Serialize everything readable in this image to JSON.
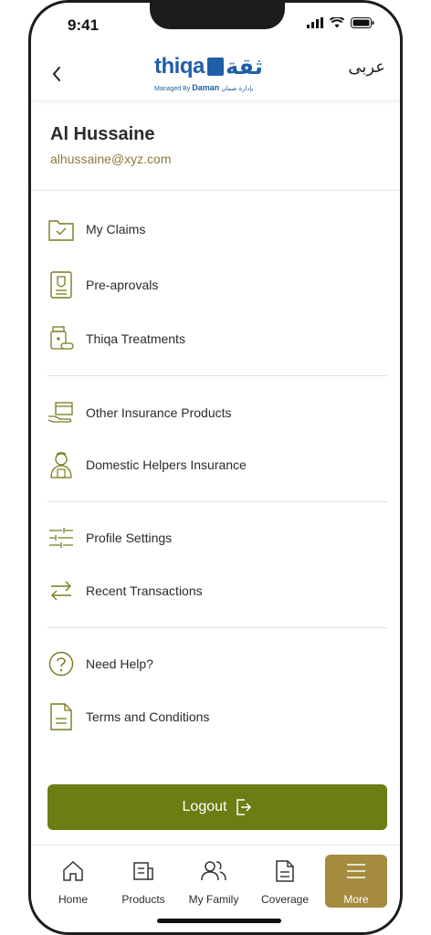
{
  "status_bar": {
    "time": "9:41"
  },
  "header": {
    "logo_wordmark": "thiqa",
    "logo_arabic": "ثقة",
    "logo_managed_by": "Managed By",
    "logo_daman": "Daman",
    "logo_daman_arabic": "بإدارة ضمان",
    "language_toggle": "عربى"
  },
  "profile": {
    "name": "Al Hussaine",
    "email": "alhussaine@xyz.com"
  },
  "menu": {
    "groups": [
      [
        {
          "label": "My Claims",
          "icon": "claims-folder-icon"
        },
        {
          "label": "Pre-aprovals",
          "icon": "certificate-icon"
        },
        {
          "label": "Thiqa Treatments",
          "icon": "medicine-bottle-icon"
        }
      ],
      [
        {
          "label": "Other Insurance Products",
          "icon": "hand-box-icon"
        },
        {
          "label": "Domestic Helpers Insurance",
          "icon": "helper-person-icon"
        }
      ],
      [
        {
          "label": "Profile Settings",
          "icon": "sliders-icon"
        },
        {
          "label": "Recent Transactions",
          "icon": "transfer-arrows-icon"
        }
      ],
      [
        {
          "label": "Need Help?",
          "icon": "help-circle-icon"
        },
        {
          "label": "Terms and Conditions",
          "icon": "document-icon"
        }
      ]
    ]
  },
  "logout": {
    "label": "Logout",
    "icon": "logout-icon"
  },
  "tab_bar": {
    "tabs": [
      {
        "label": "Home",
        "icon": "home-icon",
        "active": false
      },
      {
        "label": "Products",
        "icon": "products-icon",
        "active": false
      },
      {
        "label": "My Family",
        "icon": "family-icon",
        "active": false
      },
      {
        "label": "Coverage",
        "icon": "coverage-icon",
        "active": false
      },
      {
        "label": "More",
        "icon": "menu-lines-icon",
        "active": true
      }
    ]
  },
  "colors": {
    "accent_olive": "#6b7d13",
    "accent_gold": "#a58b3e",
    "icon_olive": "#7a7a1e",
    "brand_blue": "#1f5fa8",
    "email_text": "#8a7a3d"
  }
}
